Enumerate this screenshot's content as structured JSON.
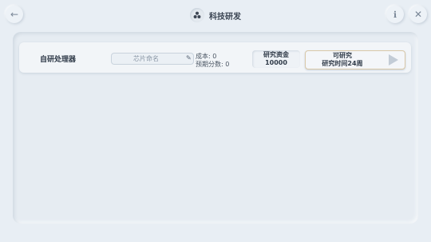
{
  "header": {
    "title": "科技研发",
    "back_icon": "←",
    "help_icon": "ℹ",
    "close_icon": "✕"
  },
  "chip_row": {
    "name": "自研处理器",
    "name_placeholder": "芯片命名",
    "edit_icon": "✎",
    "cost": "成本: 0",
    "expected_score": "预期分数: 0",
    "fund_label": "研究资金",
    "fund_value": "10000",
    "research_status": "可研究",
    "research_time": "研究时间24周"
  }
}
